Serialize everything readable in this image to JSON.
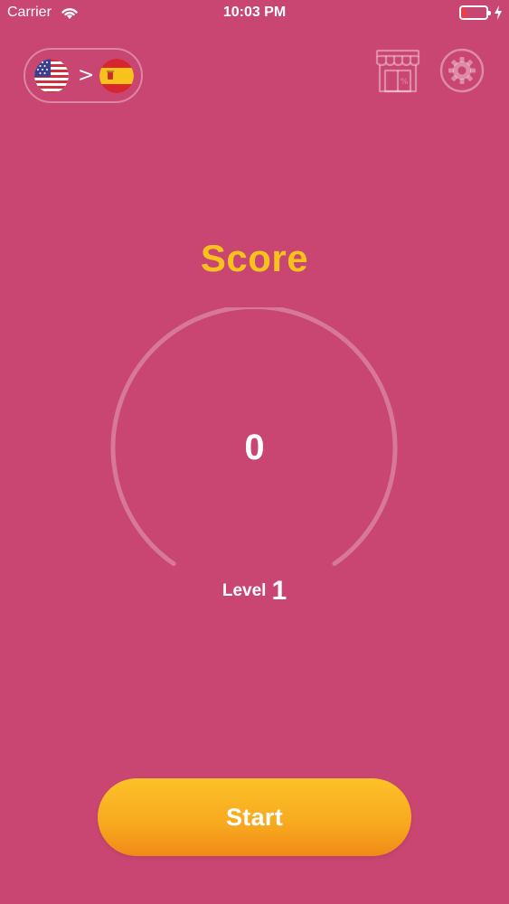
{
  "status_bar": {
    "carrier": "Carrier",
    "time": "10:03 PM",
    "battery_level": 0.15,
    "battery_color": "#ff3b30",
    "icons": [
      "wifi-icon",
      "battery-icon",
      "charging-icon"
    ]
  },
  "language": {
    "from_flag": "us-flag-icon",
    "to_flag": "spain-flag-icon",
    "arrow": ">"
  },
  "toolbar": {
    "shop_icon": "shop-icon",
    "settings_icon": "gear-icon"
  },
  "score": {
    "title": "Score",
    "value": "0",
    "gauge_progress": 0
  },
  "level": {
    "label": "Level",
    "value": "1"
  },
  "start_button": {
    "label": "Start"
  },
  "colors": {
    "background": "#c94572",
    "accent": "#f7c21c",
    "button_gradient_top": "#fcc228",
    "button_gradient_bottom": "#f08a17"
  }
}
